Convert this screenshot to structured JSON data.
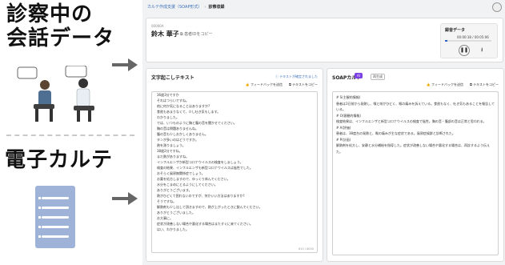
{
  "left_panel": {
    "title_top_line1": "診察中の",
    "title_top_line2": "会話データ",
    "title_bottom": "電子カルテ"
  },
  "breadcrumb": {
    "parent": "カルテ作成支援（SOAP形式）",
    "current": "診察収録"
  },
  "patient": {
    "id": "00000A",
    "name": "鈴木 華子",
    "copy_label": "患者IDをコピー"
  },
  "recording": {
    "title": "録音データ",
    "time": "00:00:18 / 00:05:06",
    "progress_fraction": 0.06
  },
  "transcript": {
    "title": "文字起こしテキスト",
    "info_text": "テキストが確定されました",
    "feedback_label": "フィードバックを送信",
    "copy_label": "テキストをコピー",
    "char_count": "610 / 8000",
    "lines": [
      "36度3分ですか",
      "それはつらいですね。",
      "他に何か気になることはありますか?",
      "食欲もあまりなくて、少し吐き気もします。",
      "わかりました。",
      "では、いつものように胸と腹の音を聞かせてください。",
      "胸の音は問題ありませんね。",
      "腹の音も少しおかしくありません。",
      "タンが多いのはどうですか。",
      "熱を測りましょう。",
      "38度2分ですね。",
      "まだ熱がありますね。",
      "インフルエンザか新型コロナウイルスの検査をしましょう。",
      "検査の結果、インフルエンザも新型コロナウイルスは陰性でした。",
      "おそらく風邪無関係症でしょう。",
      "お薬を処方しますので、ゆっくり休んでください。",
      "水分をこまめにとるようにしてください。",
      "ありがとうございます。",
      "熱がひどくて困れないのですが、何かいい方法はありますか?",
      "そうですね。",
      "解熱剤も少し出して頂きますので、熱が上がったときに飲んでください。",
      "ありがとうございました。",
      "お大事に。",
      "症状が改善しない場合や悪化する場合はまたすぐに来てください。",
      "はい、わかりました。"
    ]
  },
  "soap": {
    "title": "SOAPカルテ",
    "ai_badge": "AI",
    "regenerate_label": "再生成",
    "feedback_label": "フィードバックを送信",
    "copy_label": "テキストをコピー",
    "lines": [
      "# S(主観的情報)",
      "患者は3日前から発熱し、喉と咳がひどく、喉の痛みを訴えている。食欲もなく、吐き気もあることを報告している。",
      "# O(客観的情報)",
      "検査結果は、インフルエンザと新型コロナウイルスの検査で陰性。胸の音・腹部の音は正常と思われる。",
      "# A(評価)",
      "患者は、38度台の発熱と、喉の痛みが主な症状である。風邪症候群と診断された。",
      "# P(計画)",
      "解熱剤を処方し、安静と水分補給を指導した。症状が改善しない場合や悪化する場合は、再診するよう伝えた。"
    ]
  }
}
